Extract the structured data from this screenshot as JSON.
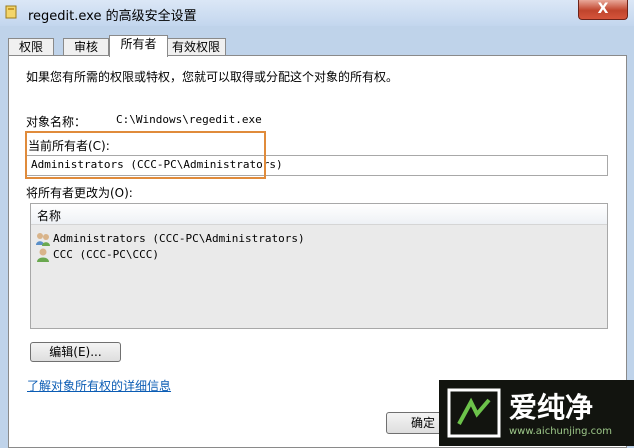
{
  "window": {
    "title": "regedit.exe 的高级安全设置",
    "close_label": "X"
  },
  "tabs": [
    {
      "label": "权限"
    },
    {
      "label": "审核"
    },
    {
      "label": "所有者"
    },
    {
      "label": "有效权限"
    }
  ],
  "owner_tab": {
    "intro": "如果您有所需的权限或特权，您就可以取得或分配这个对象的所有权。",
    "object_name_label": "对象名称：",
    "object_name_value": "C:\\Windows\\regedit.exe",
    "current_owner_label": "当前所有者(C):",
    "current_owner_value": "Administrators (CCC-PC\\Administrators)",
    "change_owner_label": "将所有者更改为(O):",
    "list_column": "名称",
    "owners": [
      {
        "name": "Administrators (CCC-PC\\Administrators)",
        "icon": "group-users-icon"
      },
      {
        "name": "CCC (CCC-PC\\CCC)",
        "icon": "user-icon"
      }
    ],
    "edit_button": "编辑(E)...",
    "learn_more_link": "了解对象所有权的详细信息"
  },
  "footer": {
    "ok_button": "确定"
  },
  "watermark": {
    "brand": "爱纯净",
    "url": "www.aichunjing.com"
  },
  "colors": {
    "highlight_box": "#e08b3b",
    "link": "#0b5cb4",
    "close_button": "#c0442c"
  }
}
